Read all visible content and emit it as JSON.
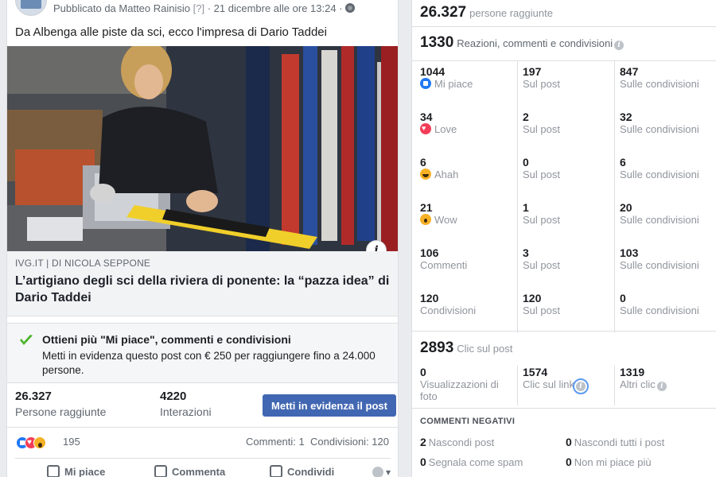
{
  "post": {
    "meta": "Pubblicato da Matteo Rainisio",
    "help": "[?]",
    "date": " · 21 dicembre alle ore 13:24 · ",
    "text": "Da Albenga alle piste da sci, ecco l'impresa di Dario Taddei",
    "link_source": "IVG.IT  |  DI NICOLA SEPPONE",
    "link_title": "L’artigiano degli sci della riviera di ponente: la “pazza idea” di Dario Taddei",
    "info_glyph": "i"
  },
  "boost": {
    "title": "Ottieni più \"Mi piace\", commenti e condivisioni",
    "desc": "Metti in evidenza questo post con € 250 per raggiungere fino a 24.000 persone."
  },
  "post_stats": {
    "reach_value": "26.327",
    "reach_label": "Persone raggiunte",
    "interactions_value": "4220",
    "interactions_label": "Interazioni",
    "boost_button": "Metti in evidenza il post"
  },
  "reactions": {
    "count": "195",
    "comments": "Commenti: 1",
    "shares": "Condivisioni: 120"
  },
  "actions": {
    "like": "Mi piace",
    "comment": "Commenta",
    "share": "Condividi"
  },
  "insights": {
    "reach": {
      "value": "26.327",
      "label": "persone raggiunte"
    },
    "reactions_total": {
      "value": "1330",
      "label": "Reazioni, commenti e condivisioni"
    },
    "rows": [
      {
        "icon": "like-icon",
        "emoji": "like",
        "value": "1044",
        "label": "Mi piace",
        "on_post": "197",
        "on_post_label": "Sul post",
        "on_shares": "847",
        "on_shares_label": "Sulle condivisioni"
      },
      {
        "icon": "love-icon",
        "emoji": "love",
        "value": "34",
        "label": "Love",
        "on_post": "2",
        "on_post_label": "Sul post",
        "on_shares": "32",
        "on_shares_label": "Sulle condivisioni"
      },
      {
        "icon": "haha-icon",
        "emoji": "haha",
        "value": "6",
        "label": "Ahah",
        "on_post": "0",
        "on_post_label": "Sul post",
        "on_shares": "6",
        "on_shares_label": "Sulle condivisioni"
      },
      {
        "icon": "wow-icon",
        "emoji": "wow",
        "value": "21",
        "label": "Wow",
        "on_post": "1",
        "on_post_label": "Sul post",
        "on_shares": "20",
        "on_shares_label": "Sulle condivisioni"
      },
      {
        "icon": "",
        "emoji": "",
        "value": "106",
        "label": "Commenti",
        "on_post": "3",
        "on_post_label": "Sul post",
        "on_shares": "103",
        "on_shares_label": "Sulle condivisioni"
      },
      {
        "icon": "",
        "emoji": "",
        "value": "120",
        "label": "Condivisioni",
        "on_post": "120",
        "on_post_label": "Sul post",
        "on_shares": "0",
        "on_shares_label": "Sulle condivisioni"
      }
    ],
    "clicks": {
      "value": "2893",
      "label": "Clic sul post",
      "views_value": "0",
      "views_label": "Visualizzazioni di foto",
      "link_value": "1574",
      "link_label": "Clic sul link",
      "other_value": "1319",
      "other_label": "Altri clic"
    },
    "negative": {
      "title": "COMMENTI NEGATIVI",
      "hide_post_value": "2",
      "hide_post_label": "Nascondi post",
      "hide_all_value": "0",
      "hide_all_label": "Nascondi tutti i post",
      "spam_value": "0",
      "spam_label": "Segnala come spam",
      "unlike_value": "0",
      "unlike_label": "Non mi piace più"
    }
  },
  "colors": {
    "accent": "#4267b2",
    "like": "#2078f4",
    "love": "#f33e58",
    "haha": "#f7b125",
    "check_green": "#4cb52c"
  }
}
